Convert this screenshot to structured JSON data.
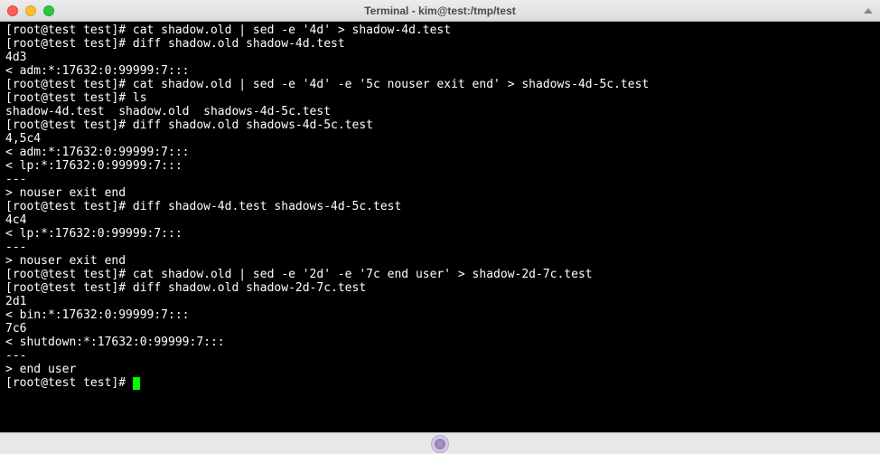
{
  "window": {
    "title": "Terminal - kim@test:/tmp/test"
  },
  "terminal": {
    "prompt": "[root@test test]# ",
    "lines": [
      "[root@test test]# cat shadow.old | sed -e '4d' > shadow-4d.test",
      "[root@test test]# diff shadow.old shadow-4d.test",
      "4d3",
      "< adm:*:17632:0:99999:7:::",
      "[root@test test]# cat shadow.old | sed -e '4d' -e '5c nouser exit end' > shadows-4d-5c.test",
      "[root@test test]# ls",
      "shadow-4d.test  shadow.old  shadows-4d-5c.test",
      "[root@test test]# diff shadow.old shadows-4d-5c.test",
      "4,5c4",
      "< adm:*:17632:0:99999:7:::",
      "< lp:*:17632:0:99999:7:::",
      "---",
      "> nouser exit end",
      "[root@test test]# diff shadow-4d.test shadows-4d-5c.test",
      "4c4",
      "< lp:*:17632:0:99999:7:::",
      "---",
      "> nouser exit end",
      "[root@test test]# cat shadow.old | sed -e '2d' -e '7c end user' > shadow-2d-7c.test",
      "[root@test test]# diff shadow.old shadow-2d-7c.test",
      "2d1",
      "< bin:*:17632:0:99999:7:::",
      "7c6",
      "< shutdown:*:17632:0:99999:7:::",
      "---",
      "> end user"
    ]
  }
}
